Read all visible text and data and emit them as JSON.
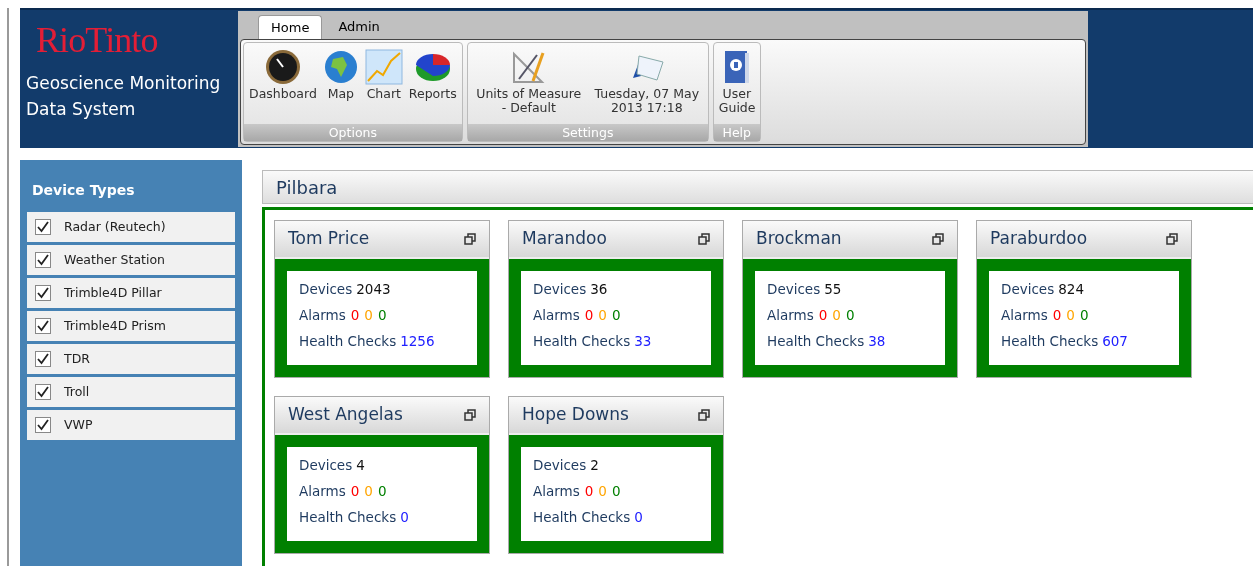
{
  "brand": {
    "logo": "RioTinto",
    "title": "Geoscience Monitoring Data System"
  },
  "ribbon": {
    "tabs": [
      {
        "label": "Home",
        "selected": true
      },
      {
        "label": "Admin",
        "selected": false
      }
    ],
    "groups": [
      {
        "label": "Options",
        "items": [
          {
            "kind": "gauge",
            "label": "Dashboard"
          },
          {
            "kind": "globe",
            "label": "Map"
          },
          {
            "kind": "chart",
            "label": "Chart"
          },
          {
            "kind": "pie",
            "label": "Reports"
          }
        ]
      },
      {
        "label": "Settings",
        "items": [
          {
            "kind": "compass",
            "label": "Units of Measure - Default"
          },
          {
            "kind": "calendar",
            "label": "Tuesday, 07 May 2013 17:18"
          }
        ]
      },
      {
        "label": "Help",
        "items": [
          {
            "kind": "book",
            "label": "User Guide"
          }
        ]
      }
    ]
  },
  "sidebar": {
    "title": "Device Types",
    "items": [
      {
        "label": "Radar (Reutech)",
        "checked": true
      },
      {
        "label": "Weather Station",
        "checked": true
      },
      {
        "label": "Trimble4D Pillar",
        "checked": true
      },
      {
        "label": "Trimble4D Prism",
        "checked": true
      },
      {
        "label": "TDR",
        "checked": true
      },
      {
        "label": "Troll",
        "checked": true
      },
      {
        "label": "VWP",
        "checked": true
      }
    ]
  },
  "region": {
    "title": "Pilbara",
    "sites": [
      {
        "name": "Tom Price",
        "devices_label": "Devices",
        "devices": "2043",
        "alarms_label": "Alarms",
        "alarms": [
          {
            "value": "0",
            "color": "#ff0000"
          },
          {
            "value": "0",
            "color": "#ffa500"
          },
          {
            "value": "0",
            "color": "#008000"
          }
        ],
        "health_label": "Health Checks",
        "health": "1256"
      },
      {
        "name": "Marandoo",
        "devices_label": "Devices",
        "devices": "36",
        "alarms_label": "Alarms",
        "alarms": [
          {
            "value": "0",
            "color": "#ff0000"
          },
          {
            "value": "0",
            "color": "#ffa500"
          },
          {
            "value": "0",
            "color": "#008000"
          }
        ],
        "health_label": "Health Checks",
        "health": "33"
      },
      {
        "name": "Brockman",
        "devices_label": "Devices",
        "devices": "55",
        "alarms_label": "Alarms",
        "alarms": [
          {
            "value": "0",
            "color": "#ff0000"
          },
          {
            "value": "0",
            "color": "#ffa500"
          },
          {
            "value": "0",
            "color": "#008000"
          }
        ],
        "health_label": "Health Checks",
        "health": "38"
      },
      {
        "name": "Paraburdoo",
        "devices_label": "Devices",
        "devices": "824",
        "alarms_label": "Alarms",
        "alarms": [
          {
            "value": "0",
            "color": "#ff0000"
          },
          {
            "value": "0",
            "color": "#ffa500"
          },
          {
            "value": "0",
            "color": "#008000"
          }
        ],
        "health_label": "Health Checks",
        "health": "607"
      },
      {
        "name": "West Angelas",
        "devices_label": "Devices",
        "devices": "4",
        "alarms_label": "Alarms",
        "alarms": [
          {
            "value": "0",
            "color": "#ff0000"
          },
          {
            "value": "0",
            "color": "#ffa500"
          },
          {
            "value": "0",
            "color": "#008000"
          }
        ],
        "health_label": "Health Checks",
        "health": "0"
      },
      {
        "name": "Hope Downs",
        "devices_label": "Devices",
        "devices": "2",
        "alarms_label": "Alarms",
        "alarms": [
          {
            "value": "0",
            "color": "#ff0000"
          },
          {
            "value": "0",
            "color": "#ffa500"
          },
          {
            "value": "0",
            "color": "#008000"
          }
        ],
        "health_label": "Health Checks",
        "health": "0"
      }
    ]
  }
}
